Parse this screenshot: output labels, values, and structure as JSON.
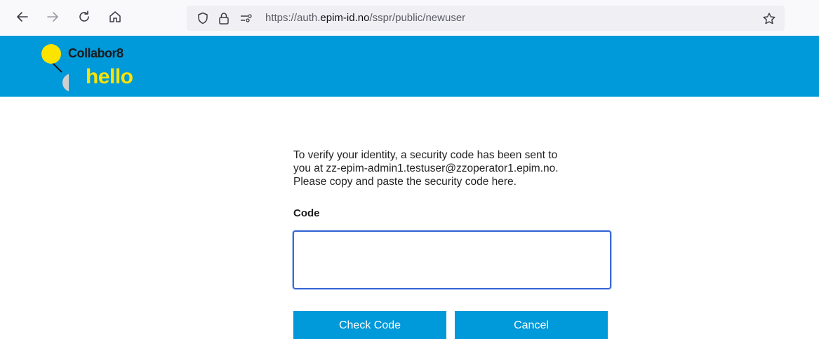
{
  "browser": {
    "url_prefix": "https://auth.",
    "url_domain": "epim-id.no",
    "url_path": "/sspr/public/newuser",
    "icons": [
      "back-icon",
      "forward-icon",
      "reload-icon",
      "home-icon",
      "shield-icon",
      "lock-icon",
      "permissions-icon",
      "bookmark-star-icon"
    ]
  },
  "brand": {
    "name": "Collabor8",
    "product": "hello",
    "banner_color": "#0099d9",
    "yellow": "#fce300"
  },
  "form": {
    "message": "To verify your identity, a security code has been sent to\nyou at zz-epim-admin1.testuser@zzoperator1.epim.no.\nPlease copy and paste the security code here.",
    "code_label": "Code",
    "code_value": "",
    "check_button": "Check Code",
    "cancel_button": "Cancel"
  }
}
